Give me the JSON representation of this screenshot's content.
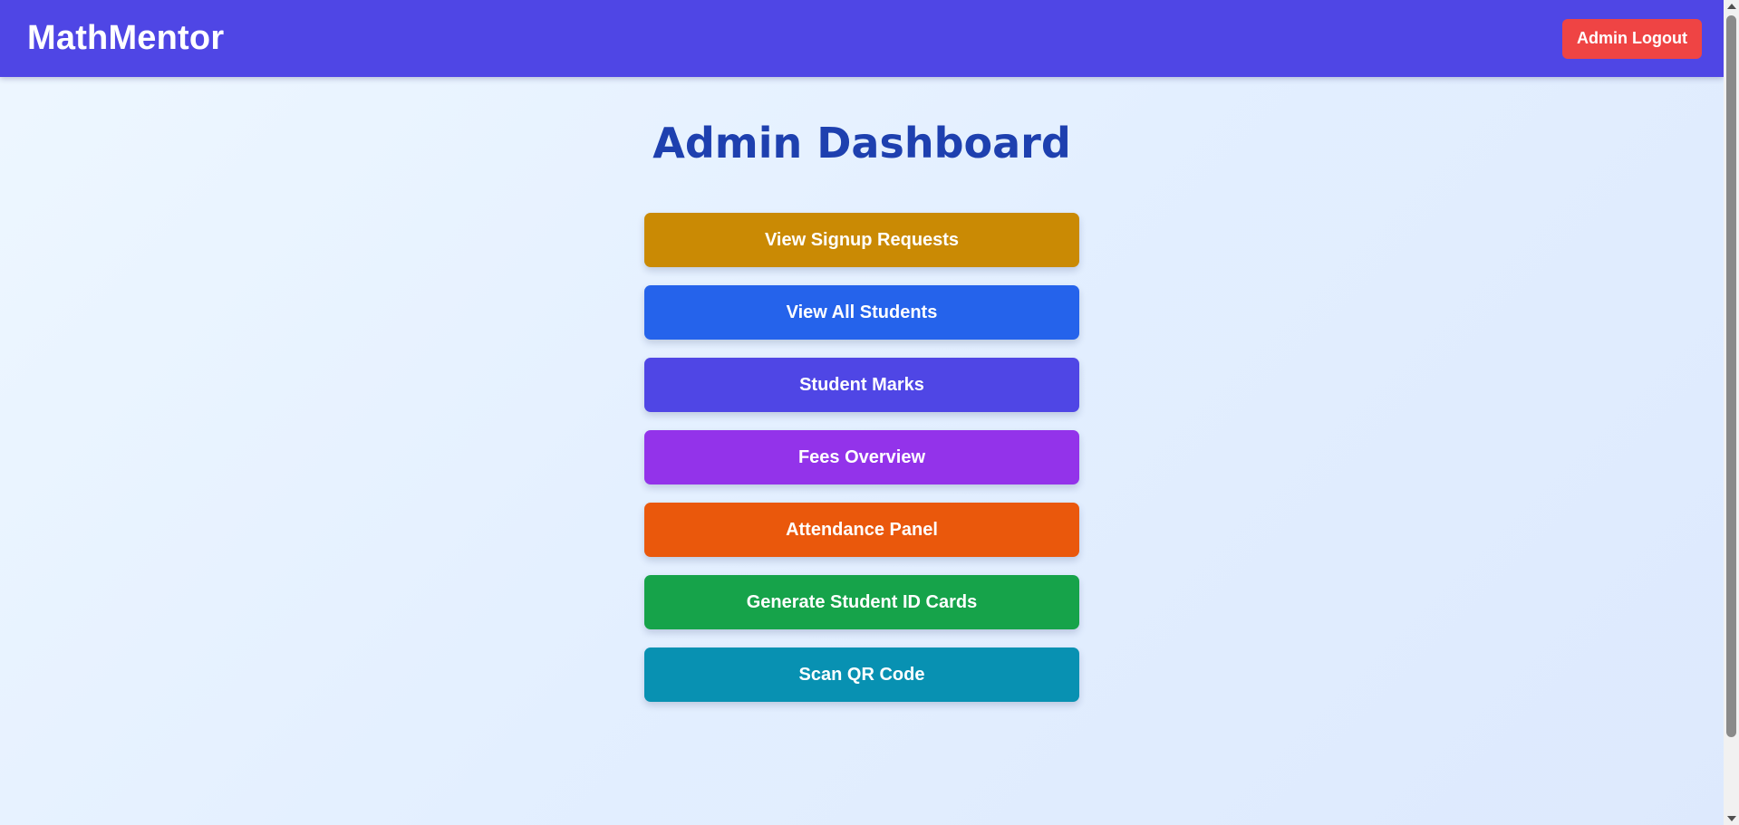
{
  "header": {
    "brand": "MathMentor",
    "logout_label": "Admin Logout",
    "background": "#4f46e5"
  },
  "main": {
    "title": "Admin Dashboard",
    "buttons": [
      {
        "label": "View Signup Requests",
        "color": "#ca8a04"
      },
      {
        "label": "View All Students",
        "color": "#2563eb"
      },
      {
        "label": "Student Marks",
        "color": "#4f46e5"
      },
      {
        "label": "Fees Overview",
        "color": "#9333ea"
      },
      {
        "label": "Attendance Panel",
        "color": "#ea580c"
      },
      {
        "label": "Generate Student ID Cards",
        "color": "#16a34a"
      },
      {
        "label": "Scan QR Code",
        "color": "#0891b2"
      }
    ]
  },
  "colors": {
    "logout": "#ef4444",
    "title": "#1e40af"
  },
  "icons": [
    "scroll-up-arrow-icon",
    "scroll-down-arrow-icon"
  ]
}
